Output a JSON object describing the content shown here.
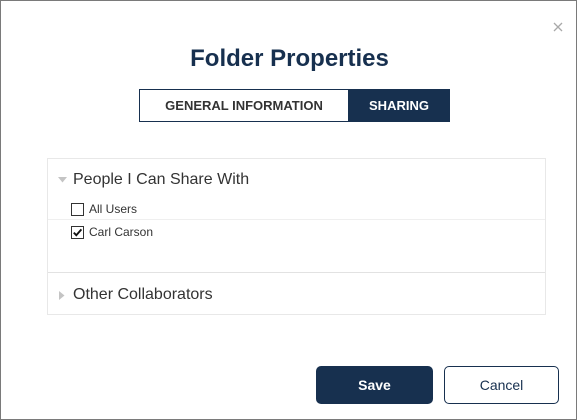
{
  "dialog": {
    "title": "Folder Properties",
    "close_icon": "close-icon"
  },
  "tabs": [
    {
      "label": "GENERAL INFORMATION",
      "active": false
    },
    {
      "label": "SHARING",
      "active": true
    }
  ],
  "sharing": {
    "people_section": {
      "label": "People I Can Share With",
      "expanded": true,
      "users": [
        {
          "label": "All Users",
          "checked": false
        },
        {
          "label": "Carl Carson",
          "checked": true
        }
      ]
    },
    "other_section": {
      "label": "Other Collaborators",
      "expanded": false
    }
  },
  "buttons": {
    "save_label": "Save",
    "cancel_label": "Cancel"
  },
  "colors": {
    "accent": "#17304f",
    "text": "#333333",
    "close": "#a9a9a9"
  }
}
